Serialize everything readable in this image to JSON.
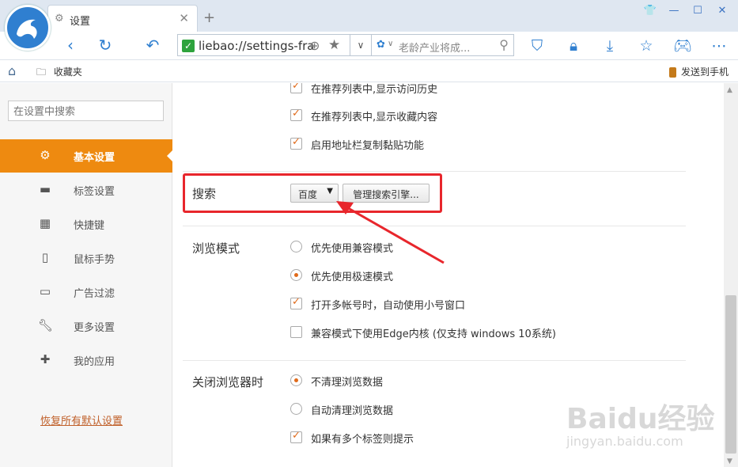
{
  "tab": {
    "title": "设置",
    "close": "✕",
    "new_tab": "+"
  },
  "address": {
    "url": "liebao://settings-fra",
    "search_placeholder": "老龄产业将成..."
  },
  "bookmarks": {
    "favorites": "收藏夹",
    "send_to_phone": "发送到手机"
  },
  "sidebar": {
    "search_placeholder": "在设置中搜索",
    "items": [
      {
        "label": "基本设置",
        "icon": "gear-icon",
        "active": true
      },
      {
        "label": "标签设置",
        "icon": "tab-icon"
      },
      {
        "label": "快捷键",
        "icon": "keyboard-icon"
      },
      {
        "label": "鼠标手势",
        "icon": "mouse-icon"
      },
      {
        "label": "广告过滤",
        "icon": "window-icon"
      },
      {
        "label": "更多设置",
        "icon": "wrench-icon"
      },
      {
        "label": "我的应用",
        "icon": "puzzle-icon"
      }
    ],
    "restore": "恢复所有默认设置"
  },
  "settings": {
    "recommend": [
      {
        "label": "在推荐列表中,显示访问历史",
        "checked": true
      },
      {
        "label": "在推荐列表中,显示收藏内容",
        "checked": true
      },
      {
        "label": "启用地址栏复制黏贴功能",
        "checked": true
      }
    ],
    "search": {
      "title": "搜索",
      "engine": "百度",
      "manage_button": "管理搜索引擎..."
    },
    "browse_mode": {
      "title": "浏览模式",
      "options": [
        {
          "label": "优先使用兼容模式",
          "type": "radio",
          "checked": false
        },
        {
          "label": "优先使用极速模式",
          "type": "radio",
          "checked": true
        },
        {
          "label": "打开多帐号时，自动使用小号窗口",
          "type": "checkbox",
          "checked": true
        },
        {
          "label": "兼容模式下使用Edge内核 (仅支持 windows 10系统)",
          "type": "checkbox",
          "checked": false
        }
      ]
    },
    "on_close": {
      "title": "关闭浏览器时",
      "options": [
        {
          "label": "不清理浏览数据",
          "type": "radio",
          "checked": true
        },
        {
          "label": "自动清理浏览数据",
          "type": "radio",
          "checked": false
        },
        {
          "label": "如果有多个标签则提示",
          "type": "checkbox",
          "checked": true
        }
      ]
    }
  },
  "watermark": {
    "brand": "Baidu经验",
    "url": "jingyan.baidu.com"
  },
  "colors": {
    "accent": "#ee8a10",
    "highlight": "#e8262c",
    "brand_blue": "#2f7fd0"
  }
}
